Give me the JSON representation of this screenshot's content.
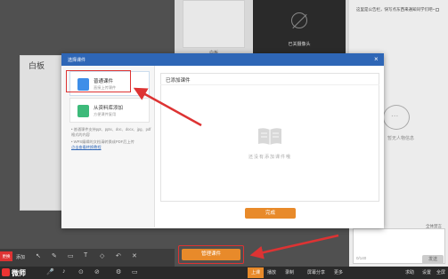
{
  "window": {
    "whiteboard_title": "白板"
  },
  "cameras": [
    {
      "label": "白板"
    },
    {
      "label": "已关摄像头"
    }
  ],
  "chat": {
    "notice": "这里是公告栏，快写点东西来通知同学们吧~",
    "notice_checkbox": "",
    "empty_text": "暂无人物信息",
    "all_ban_label": "全体禁言",
    "counter": "0/140",
    "send_label": "发送"
  },
  "wb_toolbar": {
    "prefix": "更换",
    "label": "添加",
    "icons": [
      "pointer-icon",
      "pen-icon",
      "eraser-icon",
      "text-icon",
      "shape-icon",
      "undo-icon",
      "clear-icon"
    ]
  },
  "manage_button": "管理课件",
  "bottombar": {
    "logo": "微师",
    "up_label": "上课",
    "items": [
      "播放",
      "录制",
      "屏幕分享",
      "更多"
    ],
    "right_items": [
      "求助",
      "设置",
      "全屏"
    ]
  },
  "dialog": {
    "title": "选择课件",
    "cards": [
      {
        "title": "普通课件",
        "subtitle": "直接上传课件",
        "color": "#3e8ee8"
      },
      {
        "title": "从资料库添加",
        "subtitle": "方便课件复用",
        "color": "#3dba7a"
      }
    ],
    "tips": "普通课件支持ppt、pptx、doc、docx、jpg、pdf格式的内容",
    "tips2": "WPS编辑的文档请转换成PDF后上传",
    "tips_link": "点击查看转换教程",
    "added_title": "已添加课件",
    "empty_text": "还没有添加课件哦",
    "done_label": "完成"
  },
  "colors": {
    "accent": "#e88a2a",
    "header": "#2e66b6",
    "highlight": "#d33333"
  }
}
